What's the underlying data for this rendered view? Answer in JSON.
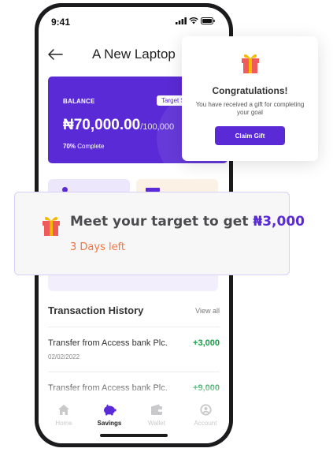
{
  "status_bar": {
    "time": "9:41"
  },
  "header": {
    "title": "A New Laptop"
  },
  "balance_card": {
    "label": "BALANCE",
    "badge": "Target Sa",
    "amount": "₦70,000.00",
    "target": "/100,000",
    "progress_percent": "70%",
    "progress_suffix": " Complete"
  },
  "transactions": {
    "title": "Transaction History",
    "view_all": "View all",
    "items": [
      {
        "description": "Transfer from Access bank Plc.",
        "amount": "+3,000",
        "date": "02/02/2022"
      },
      {
        "description": "Transfer from Access bank Plc.",
        "amount": "+9,000",
        "date": ""
      }
    ]
  },
  "tabs": [
    {
      "label": "Home",
      "icon": "home-icon",
      "active": false
    },
    {
      "label": "Savings",
      "icon": "piggy-bank-icon",
      "active": true
    },
    {
      "label": "Wallet",
      "icon": "wallet-icon",
      "active": false
    },
    {
      "label": "Account",
      "icon": "user-icon",
      "active": false
    }
  ],
  "gift_card": {
    "title": "Congratulations!",
    "message": "You have received a gift for completing your goal",
    "button": "Claim Gift"
  },
  "target_card": {
    "text": "Meet your target to get ",
    "reward": "₦3,000",
    "days_left": "3 Days left"
  },
  "colors": {
    "brand": "#5a2ad6",
    "positive": "#1b9b48",
    "warning": "#f0763f"
  }
}
